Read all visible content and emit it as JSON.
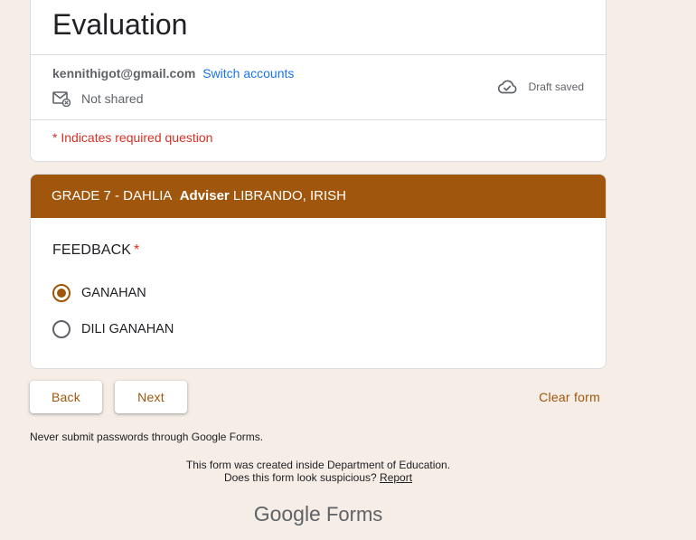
{
  "form": {
    "title": "Evaluation",
    "account_email": "kennithigot@gmail.com",
    "switch_accounts": "Switch accounts",
    "not_shared": "Not shared",
    "draft_status": "Draft saved",
    "required_note": "* Indicates required question"
  },
  "section": {
    "title_main": "GRADE 7 - DAHLIA",
    "title_bold": "Adviser",
    "title_rest": "LIBRANDO, IRISH",
    "color": "#a0560c"
  },
  "question": {
    "title": "FEEDBACK",
    "required_mark": "*",
    "options": [
      {
        "label": "GANAHAN",
        "selected": true
      },
      {
        "label": "DILI GANAHAN",
        "selected": false
      }
    ]
  },
  "nav": {
    "back_label": "Back",
    "next_label": "Next",
    "clear_label": "Clear form"
  },
  "footer": {
    "warning": "Never submit passwords through Google Forms.",
    "created_inside": "This form was created inside Department of Education.",
    "suspicious": "Does this form look suspicious?",
    "report": "Report",
    "brand_google": "Google",
    "brand_forms": "Forms"
  },
  "icons": {
    "not_shared": "mail-not-shared-icon",
    "draft": "cloud-check-icon"
  }
}
